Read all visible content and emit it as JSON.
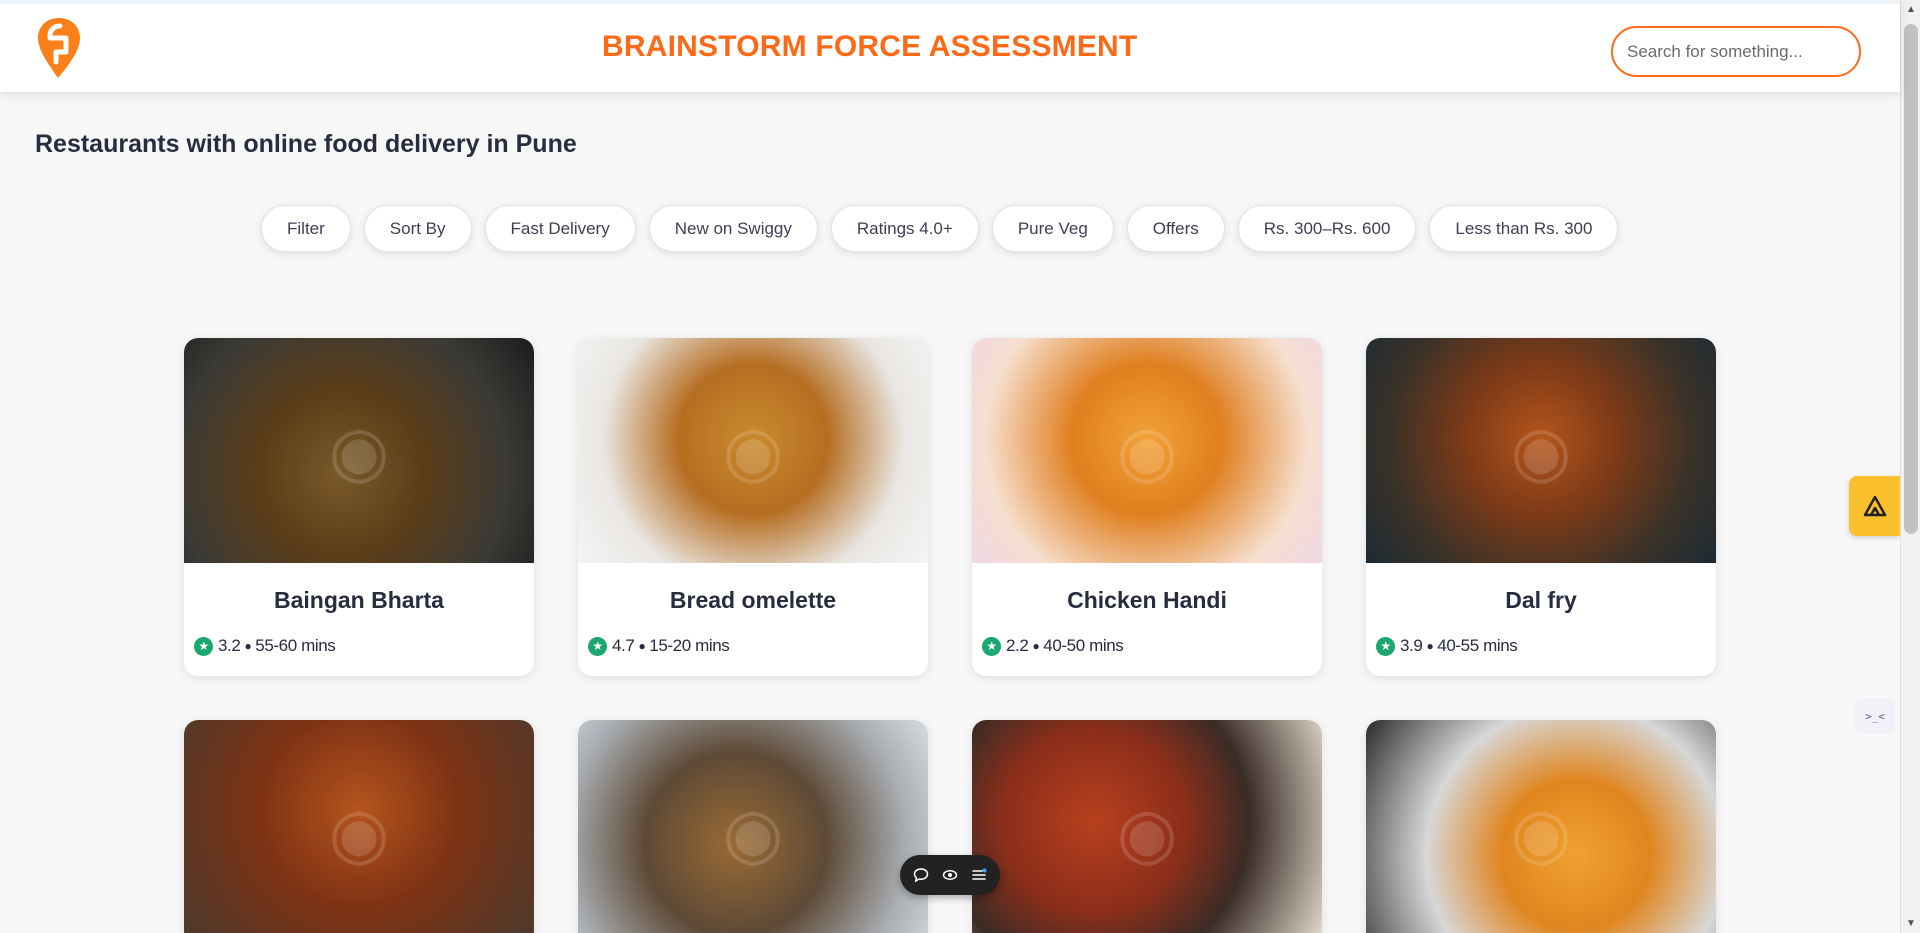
{
  "header": {
    "title": "BRAINSTORM FORCE ASSESSMENT",
    "search_placeholder": "Search for something...",
    "brand_color": "#fc6a17"
  },
  "main": {
    "heading": "Restaurants with online food delivery in Pune"
  },
  "filters": [
    "Filter",
    "Sort By",
    "Fast Delivery",
    "New on Swiggy",
    "Ratings 4.0+",
    "Pure Veg",
    "Offers",
    "Rs. 300–Rs. 600",
    "Less than Rs. 300"
  ],
  "restaurants": [
    {
      "name": "Baingan Bharta",
      "rating": "3.2",
      "time": "55-60 mins"
    },
    {
      "name": "Bread omelette",
      "rating": "4.7",
      "time": "15-20 mins"
    },
    {
      "name": "Chicken Handi",
      "rating": "2.2",
      "time": "40-50 mins"
    },
    {
      "name": "Dal fry",
      "rating": "3.9",
      "time": "40-55 mins"
    },
    {
      "name": "",
      "rating": "",
      "time": ""
    },
    {
      "name": "",
      "rating": "",
      "time": ""
    },
    {
      "name": "",
      "rating": "",
      "time": ""
    },
    {
      "name": "",
      "rating": "",
      "time": ""
    }
  ],
  "icons": {
    "logo": "swiggy-logo-icon",
    "rating": "star-icon",
    "widget": "extension-widget-icon",
    "toolbar": [
      "comment-icon",
      "eye-icon",
      "menu-icon"
    ]
  },
  "colors": {
    "rating_green": "#1ba672",
    "widget_yellow": "#fbc02d"
  }
}
